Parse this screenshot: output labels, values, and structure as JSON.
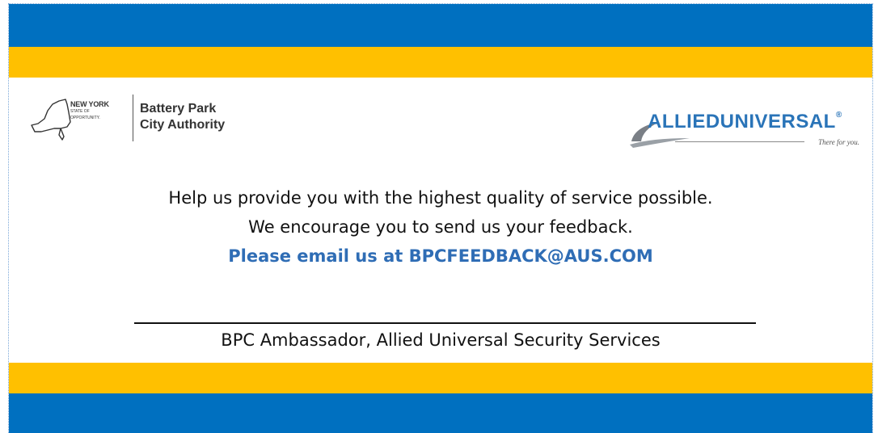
{
  "colors": {
    "band_blue": "#0070c0",
    "band_gold": "#ffc000",
    "email_blue": "#2f6db5",
    "allied_blue": "#2a74b8"
  },
  "ny_logo": {
    "wordmark": "NEW YORK",
    "sub_line1": "STATE OF",
    "sub_line2": "OPPORTUNITY.",
    "org_line1": "Battery Park",
    "org_line2": "City Authority"
  },
  "allied_logo": {
    "name": "ALLIEDUNIVERSAL",
    "registered": "®",
    "tagline": "There for you."
  },
  "message": {
    "line1": "Help us provide you with the highest quality of service possible.",
    "line2": "We encourage you to send us your feedback.",
    "line3": "Please email us at BPCFEEDBACK@AUS.COM"
  },
  "signature": {
    "label": "BPC Ambassador, Allied Universal Security Services"
  }
}
